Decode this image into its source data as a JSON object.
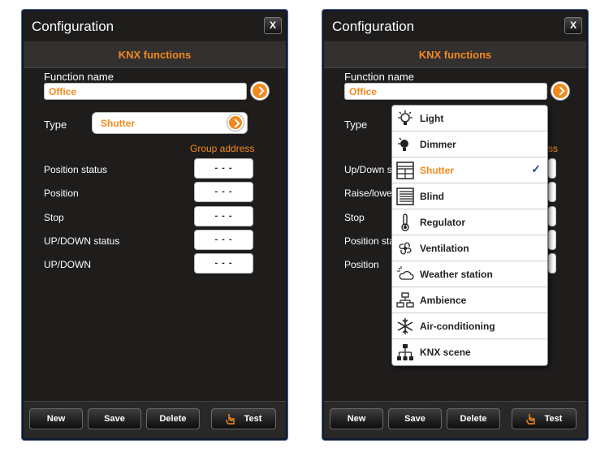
{
  "left": {
    "title": "Configuration",
    "close": "X",
    "subtitle": "KNX functions",
    "function_name_label": "Function name",
    "function_name_value": "Office",
    "type_label": "Type",
    "type_value": "Shutter",
    "group_address_header": "Group address",
    "rows": [
      {
        "label": "Position status",
        "value": "- - -"
      },
      {
        "label": "Position",
        "value": "- - -"
      },
      {
        "label": "Stop",
        "value": "- - -"
      },
      {
        "label": "UP/DOWN status",
        "value": "- - -"
      },
      {
        "label": "UP/DOWN",
        "value": "- - -"
      }
    ]
  },
  "right": {
    "title": "Configuration",
    "close": "X",
    "subtitle": "KNX functions",
    "function_name_label": "Function name",
    "function_name_value": "Office",
    "type_label": "Type",
    "group_address_header_partial": "ss",
    "rows": [
      {
        "label": "Up/Down s"
      },
      {
        "label": "Raise/lowe"
      },
      {
        "label": "Stop"
      },
      {
        "label": "Position sta"
      },
      {
        "label": "Position"
      }
    ]
  },
  "bottom_buttons": {
    "new": "New",
    "save": "Save",
    "delete": "Delete",
    "test": "Test"
  },
  "type_dropdown": {
    "selected": "Shutter",
    "check_mark": "✓",
    "items": [
      {
        "label": "Light",
        "icon": "light-bulb-icon"
      },
      {
        "label": "Dimmer",
        "icon": "dimmer-bulb-icon"
      },
      {
        "label": "Shutter",
        "icon": "shutter-icon"
      },
      {
        "label": "Blind",
        "icon": "blind-icon"
      },
      {
        "label": "Regulator",
        "icon": "thermometer-icon"
      },
      {
        "label": "Ventilation",
        "icon": "fan-icon"
      },
      {
        "label": "Weather station",
        "icon": "weather-icon"
      },
      {
        "label": "Ambience",
        "icon": "ambience-icon"
      },
      {
        "label": "Air-conditioning",
        "icon": "snowflake-icon"
      },
      {
        "label": "KNX scene",
        "icon": "network-scene-icon"
      }
    ]
  },
  "colors": {
    "accent": "#f28a1e",
    "panel_bg": "#1f1c1c",
    "check": "#234a9a"
  }
}
